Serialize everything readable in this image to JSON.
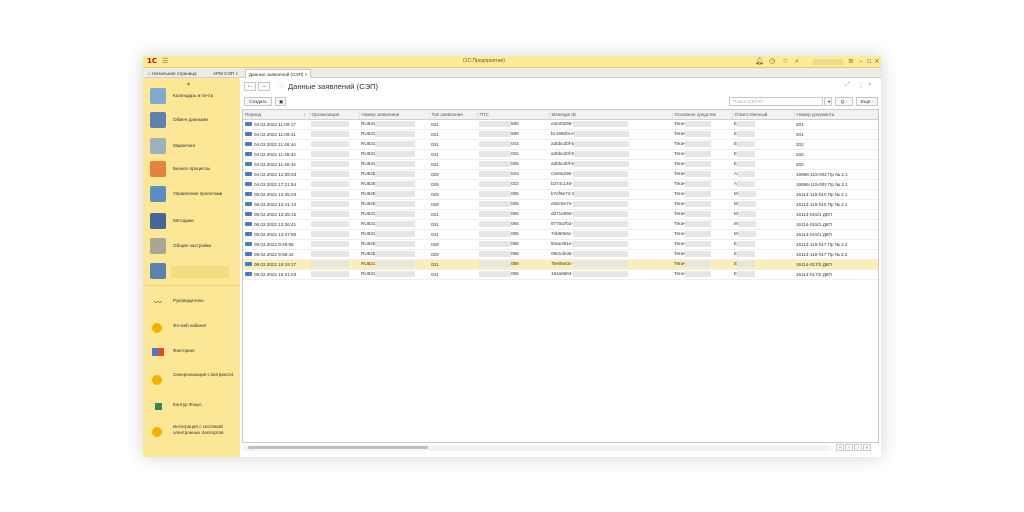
{
  "titlebar": {
    "logo": "1С",
    "title": "(1С:Предприятие)",
    "icons": [
      "bell-icon",
      "history-icon",
      "star-icon",
      "search-icon",
      "settings-icon",
      "minimize-icon",
      "maximize-icon",
      "close-icon"
    ]
  },
  "tabs": [
    {
      "label": "Начальная страница",
      "icon": "home-icon"
    },
    {
      "label": "АРМ СЭП",
      "close": "×"
    },
    {
      "label": "Данные заявлений (СЭП)",
      "close": "×"
    }
  ],
  "sidebar": {
    "items": [
      {
        "label": "Календарь и почта",
        "icon": "calendar-icon"
      },
      {
        "label": "Обмен данными",
        "icon": "data-exchange-icon"
      },
      {
        "label": "Маркетинг",
        "icon": "marketing-icon"
      },
      {
        "label": "Бизнес-процессы",
        "icon": "business-process-icon"
      },
      {
        "label": "Управление проектами",
        "icon": "project-icon"
      },
      {
        "label": "Методики",
        "icon": "book-icon"
      },
      {
        "label": "Общие настройки",
        "icon": "gears-icon"
      },
      {
        "label": "",
        "icon": "data-exchange-icon"
      },
      {
        "label": "Руководителю",
        "icon": "chart-line-icon"
      },
      {
        "label": "Фл web кабинет",
        "icon": "circle-icon"
      },
      {
        "label": "Факторинг",
        "icon": "factoring-icon"
      },
      {
        "label": "Синхронизация с Битрикс24",
        "icon": "circle-icon"
      },
      {
        "label": "Контур Фокус",
        "icon": "square-icon"
      },
      {
        "label": "Интеграция с системой электронных паспортов",
        "icon": "circle-icon"
      }
    ]
  },
  "form": {
    "title": "Данные заявлений (СЭП)",
    "back": "←",
    "forward": "→",
    "star": "☆",
    "link_icon": "⤢",
    "more_icon": "⋮",
    "close_icon": "×"
  },
  "toolbar": {
    "create": "Создать",
    "search_placeholder": "Поиск (Ctrl+F)",
    "search_btn": "Q -",
    "more": "Еще -"
  },
  "table": {
    "columns": [
      "Период",
      "Организация",
      "Номер заявления",
      "Тип заявления",
      "ПТС",
      "Message ID",
      "Основное средство",
      "Ответственный",
      "Номер документа"
    ],
    "rows": [
      {
        "period": "04.02.2022 11:09:17",
        "nomer": "RU831",
        "tip": "031",
        "pts": "688",
        "msg": "e3e20258-",
        "os": "Тягач",
        "otv": "Е",
        "doc": "201"
      },
      {
        "period": "04.02.2022 11:09:41",
        "nomer": "RU831",
        "tip": "031",
        "pts": "688",
        "msg": "bc1960fa-e",
        "os": "Тягач",
        "otv": "Е",
        "doc": "201"
      },
      {
        "period": "04.02.2022 11:48:44",
        "nomer": "RU831",
        "tip": "031",
        "pts": "043",
        "msg": "a3bbcd0f-5",
        "os": "Тягач",
        "otv": "Е",
        "doc": "202"
      },
      {
        "period": "04.02.2022 11:48:44",
        "nomer": "RU831",
        "tip": "031",
        "pts": "022",
        "msg": "a3bbcd0f-5",
        "os": "Тягач",
        "otv": "Е",
        "doc": "202"
      },
      {
        "period": "04.02.2022 11:48:44",
        "nomer": "RU831",
        "tip": "031",
        "pts": "065",
        "msg": "a3bbcd0f-5",
        "os": "Тягач",
        "otv": "Е",
        "doc": "202"
      },
      {
        "period": "04.02.2022 12:08:33",
        "nomer": "RU825",
        "tip": "029",
        "pts": "043",
        "msg": "c2e0a290-",
        "os": "Тягач",
        "otv": "А",
        "doc": "16896-115-002 Пр № 2.1"
      },
      {
        "period": "04.02.2022 17:21:54",
        "nomer": "RU825",
        "tip": "029",
        "pts": "022",
        "msg": "b374c140-",
        "os": "Тягач",
        "otv": "А",
        "doc": "16896-115-002 Пр № 2.1"
      },
      {
        "period": "08.02.2022 12:35:33",
        "nomer": "RU825",
        "tip": "029",
        "pts": "065",
        "msg": "b7ef9e74-2",
        "os": "Тягач",
        "otv": "М",
        "doc": "16114-115-010 Пр № 2.1"
      },
      {
        "period": "08.02.2022 12:41:14",
        "nomer": "RU825",
        "tip": "029",
        "pts": "065",
        "msg": "e55c5e7e-",
        "os": "Тягач",
        "otv": "М",
        "doc": "16114-115-010 Пр № 2.1"
      },
      {
        "period": "08.02.2022 13:35:15",
        "nomer": "RU831",
        "tip": "031",
        "pts": "065",
        "msg": "dd71e550-",
        "os": "Тягач",
        "otv": "М",
        "doc": "16114-015/1 ДКП"
      },
      {
        "period": "08.02.2022 13:36:41",
        "nomer": "RU831",
        "tip": "031",
        "pts": "065",
        "msg": "8770a7b3-",
        "os": "Тягач",
        "otv": "М",
        "doc": "16114-015/1 ДКП"
      },
      {
        "period": "08.02.2022 13:47:50",
        "nomer": "RU831",
        "tip": "031",
        "pts": "065",
        "msg": "7eb60e5c-",
        "os": "Тягач",
        "otv": "М",
        "doc": "16114-015/1 ДКП"
      },
      {
        "period": "09.02.2022 9:49:55",
        "nomer": "RU825",
        "tip": "029",
        "pts": "088",
        "msg": "94ae391e-",
        "os": "Тягач",
        "otv": "Е",
        "doc": "16114-115-017 Пр № 2.2"
      },
      {
        "period": "09.02.2022 9:58:42",
        "nomer": "RU825",
        "tip": "029",
        "pts": "088",
        "msg": "09e1de36-",
        "os": "Тягач",
        "otv": "Е",
        "doc": "16114-115-017 Пр № 2.2"
      },
      {
        "period": "09.02.2022 16:19:17",
        "nomer": "RU831",
        "tip": "031",
        "pts": "088",
        "msg": "7be05e3c-",
        "os": "Тягач",
        "otv": "Е",
        "doc": "16114-017/2 ДКП"
      },
      {
        "period": "09.02.2022 16:21:03",
        "nomer": "RU831",
        "tip": "031",
        "pts": "088",
        "msg": "184a6664-",
        "os": "Тягач",
        "otv": "Е",
        "doc": "16114-017/2 ДКП"
      }
    ],
    "selected_row": 14
  },
  "pager": {
    "first": "«",
    "prev": "‹",
    "next": "›",
    "last": "»"
  }
}
